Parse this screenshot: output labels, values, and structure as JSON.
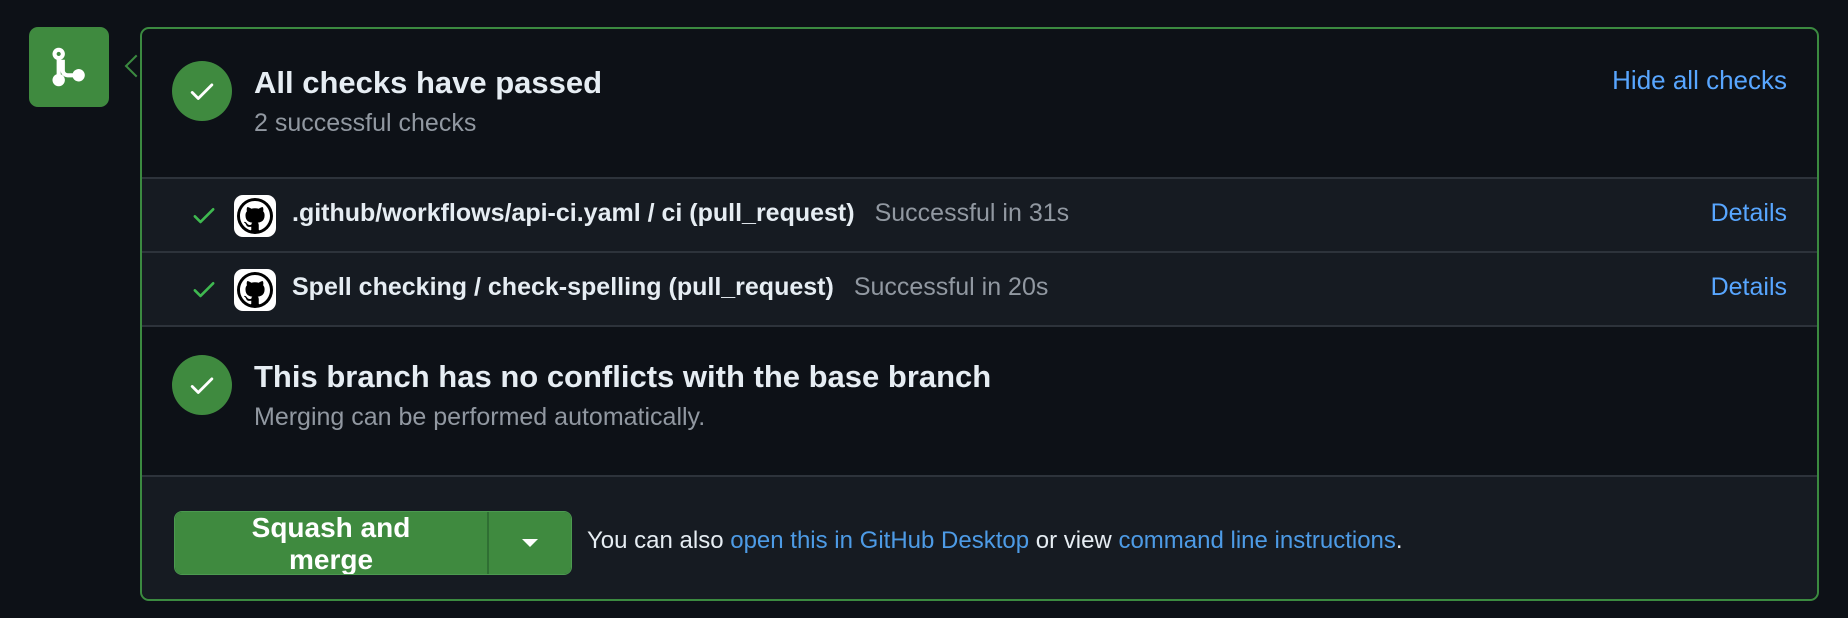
{
  "icons": {
    "branch": "git-merge-icon",
    "check": "check-circle-icon",
    "github": "github-mark-icon",
    "caret": "triangle-down-icon"
  },
  "colors": {
    "success": "#3f8a3f",
    "link": "#58a6ff",
    "background": "#0d1117",
    "muted": "#9198a1"
  },
  "checks_section": {
    "title": "All checks have passed",
    "subtitle": "2 successful checks",
    "toggle_label": "Hide all checks"
  },
  "checks": [
    {
      "name": ".github/workflows/api-ci.yaml / ci (pull_request)",
      "status": "Successful in 31s",
      "details_label": "Details"
    },
    {
      "name": "Spell checking / check-spelling (pull_request)",
      "status": "Successful in 20s",
      "details_label": "Details"
    }
  ],
  "merge_status": {
    "title": "This branch has no conflicts with the base branch",
    "subtitle": "Merging can be performed automatically."
  },
  "merge_action": {
    "button_label": "Squash and merge",
    "text_prefix": "You can also",
    "desktop_link": "open this in GitHub Desktop",
    "text_middle": "or view",
    "cli_link": "command line instructions",
    "text_suffix": "."
  }
}
